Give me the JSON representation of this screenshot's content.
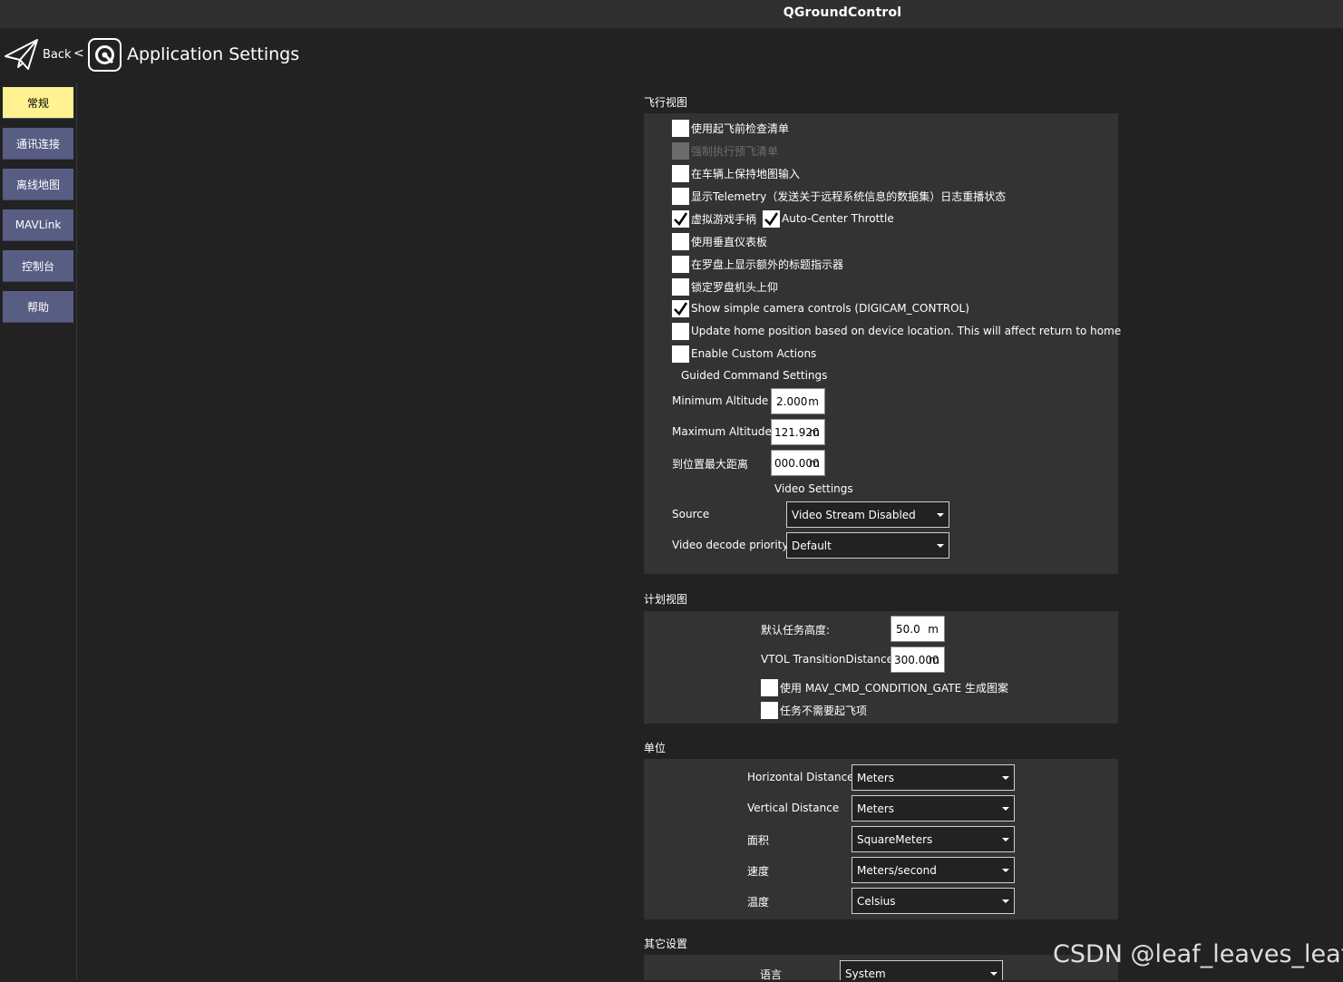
{
  "window": {
    "title": "QGroundControl"
  },
  "toolbar": {
    "back_label": "Back",
    "separator": "<",
    "page_title": "Application Settings"
  },
  "sidebar": {
    "items": [
      {
        "label": "常规",
        "active": true
      },
      {
        "label": "通讯连接",
        "active": false
      },
      {
        "label": "离线地图",
        "active": false
      },
      {
        "label": "MAVLink",
        "active": false
      },
      {
        "label": "控制台",
        "active": false
      },
      {
        "label": "帮助",
        "active": false
      }
    ]
  },
  "fly_view": {
    "header": "飞行视图",
    "checkboxes": [
      {
        "label": "使用起飞前检查清单",
        "checked": false,
        "enabled": true
      },
      {
        "label": "强制执行预飞清单",
        "checked": false,
        "enabled": false
      },
      {
        "label": "在车辆上保持地图输入",
        "checked": false,
        "enabled": true
      },
      {
        "label": "显示Telemetry（发送关于远程系统信息的数据集）日志重播状态",
        "checked": false,
        "enabled": true
      },
      {
        "label": "虚拟游戏手柄",
        "checked": true,
        "enabled": true
      },
      {
        "label": "使用垂直仪表板",
        "checked": false,
        "enabled": true
      },
      {
        "label": "在罗盘上显示额外的标题指示器",
        "checked": false,
        "enabled": true
      },
      {
        "label": "锁定罗盘机头上仰",
        "checked": false,
        "enabled": true
      },
      {
        "label": "Show simple camera controls (DIGICAM_CONTROL)",
        "checked": true,
        "enabled": true
      },
      {
        "label": "Update home position based on device location. This will affect return to home",
        "checked": false,
        "enabled": true
      },
      {
        "label": "Enable Custom Actions",
        "checked": false,
        "enabled": true
      }
    ],
    "auto_center": {
      "label": "Auto-Center Throttle",
      "checked": true
    },
    "guided_header": "Guided Command Settings",
    "min_alt": {
      "label": "Minimum Altitude",
      "value": "2.000",
      "unit": "m"
    },
    "max_alt": {
      "label": "Maximum Altitude",
      "value": "121.920",
      "unit": "m"
    },
    "max_dist": {
      "label": "到位置最大距离",
      "value": "000.000",
      "unit": "m"
    },
    "video_header": "Video Settings",
    "source": {
      "label": "Source",
      "value": "Video Stream Disabled"
    },
    "decode": {
      "label": "Video decode priority",
      "value": "Default"
    }
  },
  "plan_view": {
    "header": "计划视图",
    "default_alt": {
      "label": "默认任务高度:",
      "value": "50.0",
      "unit": "m"
    },
    "vtol": {
      "label": "VTOL TransitionDistance",
      "value": "300.000",
      "unit": "m"
    },
    "gate": {
      "label": "使用 MAV_CMD_CONDITION_GATE 生成图案",
      "checked": false
    },
    "no_takeoff": {
      "label": "任务不需要起飞项",
      "checked": false
    }
  },
  "units": {
    "header": "单位",
    "rows": [
      {
        "label": "Horizontal Distance",
        "value": "Meters"
      },
      {
        "label": "Vertical Distance",
        "value": "Meters"
      },
      {
        "label": "面积",
        "value": "SquareMeters"
      },
      {
        "label": "速度",
        "value": "Meters/second"
      },
      {
        "label": "温度",
        "value": "Celsius"
      }
    ]
  },
  "misc": {
    "header": "其它设置",
    "language": {
      "label": "语言",
      "value": "System"
    }
  },
  "watermark": "CSDN @leaf_leaves_leaf",
  "colors": {
    "active_nav": "#fff291",
    "nav": "#585d83",
    "panel": "#333333",
    "background": "#222222"
  }
}
